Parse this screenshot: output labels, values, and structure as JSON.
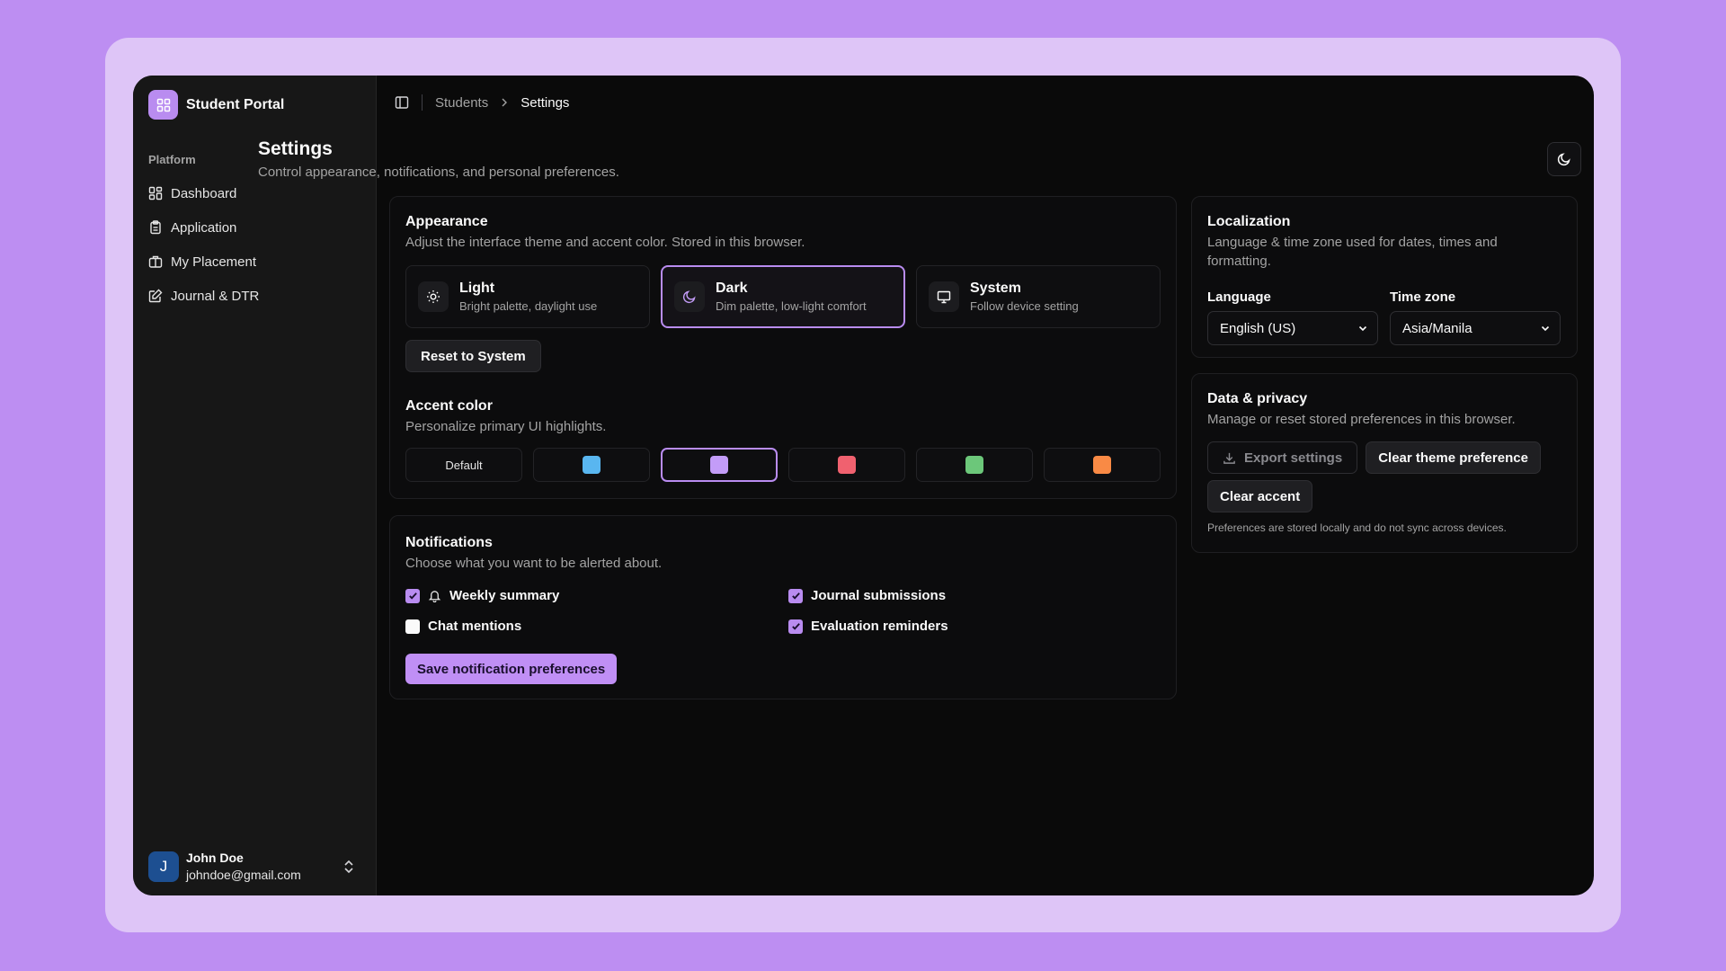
{
  "app": {
    "name": "Student Portal"
  },
  "sidebar": {
    "group_label": "Platform",
    "items": [
      {
        "label": "Dashboard",
        "icon": "dashboard-icon"
      },
      {
        "label": "Application",
        "icon": "clipboard-icon"
      },
      {
        "label": "My Placement",
        "icon": "briefcase-icon"
      },
      {
        "label": "Journal & DTR",
        "icon": "edit-square-icon"
      }
    ],
    "user": {
      "initial": "J",
      "name": "John Doe",
      "email": "johndoe@gmail.com"
    }
  },
  "breadcrumb": {
    "parent": "Students",
    "current": "Settings"
  },
  "page": {
    "title": "Settings",
    "subtitle": "Control appearance, notifications, and personal preferences."
  },
  "appearance": {
    "title": "Appearance",
    "subtitle": "Adjust the interface theme and accent color. Stored in this browser.",
    "themes": [
      {
        "name": "Light",
        "desc": "Bright palette, daylight use",
        "icon": "sun-icon",
        "active": false
      },
      {
        "name": "Dark",
        "desc": "Dim palette, low-light comfort",
        "icon": "moon-icon",
        "active": true
      },
      {
        "name": "System",
        "desc": "Follow device setting",
        "icon": "monitor-icon",
        "active": false
      }
    ],
    "reset_label": "Reset to System",
    "accent_title": "Accent color",
    "accent_subtitle": "Personalize primary UI highlights.",
    "accent_default_label": "Default",
    "accents": [
      "#59b6f0",
      "#c39cf8",
      "#f0616f",
      "#6cc77a",
      "#f98a45"
    ],
    "selected_accent": "#c39cf8"
  },
  "notifications": {
    "title": "Notifications",
    "subtitle": "Choose what you want to be alerted about.",
    "options": [
      {
        "label": "Weekly summary",
        "checked": true
      },
      {
        "label": "Journal submissions",
        "checked": true
      },
      {
        "label": "Chat mentions",
        "checked": false
      },
      {
        "label": "Evaluation reminders",
        "checked": true
      }
    ],
    "save_label": "Save notification preferences"
  },
  "localization": {
    "title": "Localization",
    "subtitle": "Language & time zone used for dates, times and formatting.",
    "language_label": "Language",
    "language_value": "English (US)",
    "timezone_label": "Time zone",
    "timezone_value": "Asia/Manila"
  },
  "privacy": {
    "title": "Data & privacy",
    "subtitle": "Manage or reset stored preferences in this browser.",
    "export_label": "Export settings",
    "clear_theme_label": "Clear theme preference",
    "clear_accent_label": "Clear accent",
    "note": "Preferences are stored locally and do not sync across devices."
  },
  "colors": {
    "accent": "#b98cf0",
    "background": "#0a0a0a",
    "page": "#bd8ef2"
  }
}
